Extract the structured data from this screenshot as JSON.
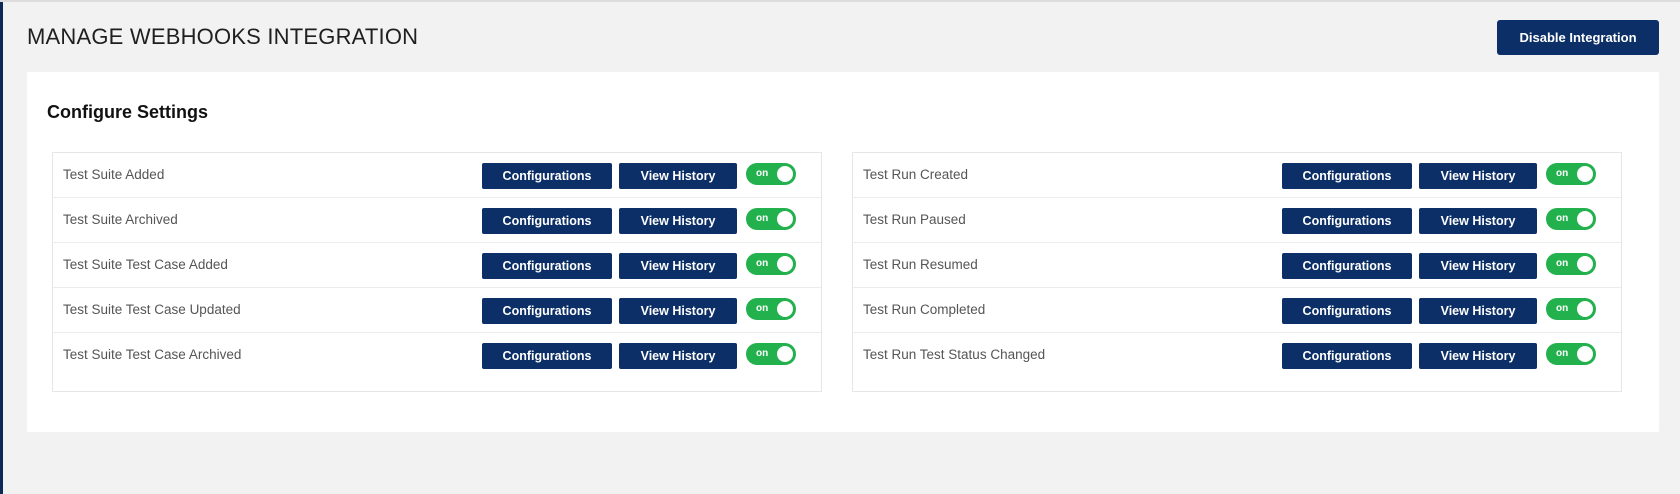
{
  "header": {
    "title": "MANAGE WEBHOOKS INTEGRATION",
    "disable_label": "Disable Integration"
  },
  "settings": {
    "title": "Configure Settings",
    "configurations_label": "Configurations",
    "view_history_label": "View History",
    "toggle_on_label": "on",
    "left_events": [
      {
        "label": "Test Suite Added",
        "enabled": true
      },
      {
        "label": "Test Suite Archived",
        "enabled": true
      },
      {
        "label": "Test Suite Test Case Added",
        "enabled": true
      },
      {
        "label": "Test Suite Test Case Updated",
        "enabled": true
      },
      {
        "label": "Test Suite Test Case Archived",
        "enabled": true
      }
    ],
    "right_events": [
      {
        "label": "Test Run Created",
        "enabled": true
      },
      {
        "label": "Test Run Paused",
        "enabled": true
      },
      {
        "label": "Test Run Resumed",
        "enabled": true
      },
      {
        "label": "Test Run Completed",
        "enabled": true
      },
      {
        "label": "Test Run Test Status Changed",
        "enabled": true
      }
    ]
  },
  "colors": {
    "primary": "#0b2f66",
    "toggle_on": "#22b14c",
    "background": "#f2f2f2"
  }
}
